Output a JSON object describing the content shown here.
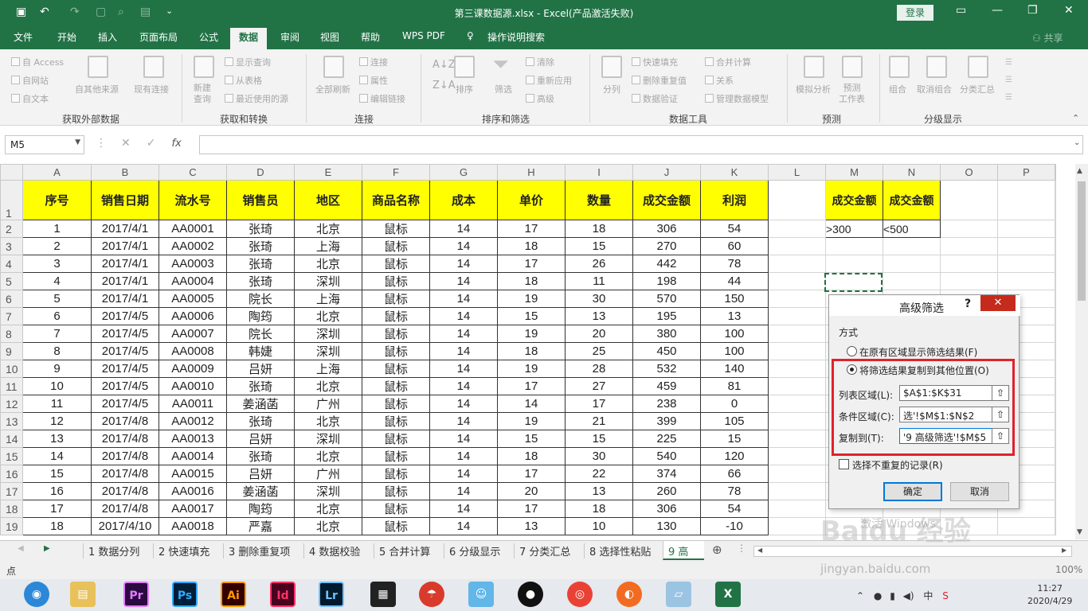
{
  "titlebar": {
    "title": "第三课数据源.xlsx  -  Excel(产品激活失败)",
    "login": "登录"
  },
  "tabs": [
    "文件",
    "开始",
    "插入",
    "页面布局",
    "公式",
    "数据",
    "审阅",
    "视图",
    "帮助",
    "WPS PDF",
    "操作说明搜索"
  ],
  "share": "共享",
  "ribbon": {
    "get_external": {
      "access": "自 Access",
      "web": "自网站",
      "text": "自文本",
      "other": "自其他来源",
      "existing": "现有连接",
      "group": "获取外部数据"
    },
    "transform": {
      "new_query": "新建\n查询",
      "show_queries": "显示查询",
      "from_table": "从表格",
      "recent": "最近使用的源",
      "group": "获取和转换"
    },
    "connections": {
      "refresh_all": "全部刷新",
      "connections": "连接",
      "properties": "属性",
      "edit_links": "编辑链接",
      "group": "连接"
    },
    "sort_filter": {
      "sort": "排序",
      "filter": "筛选",
      "clear": "清除",
      "reapply": "重新应用",
      "advanced": "高级",
      "group": "排序和筛选"
    },
    "data_tools": {
      "split": "分列",
      "flash_fill": "快速填充",
      "remove_dup": "删除重复值",
      "validation": "数据验证",
      "consolidate": "合并计算",
      "relations": "关系",
      "manage_model": "管理数据模型",
      "group": "数据工具"
    },
    "forecast": {
      "what_if": "模拟分析",
      "forecast_sheet": "预测\n工作表",
      "group": "预测"
    },
    "outline": {
      "group_btn": "组合",
      "ungroup": "取消组合",
      "subtotal": "分类汇总",
      "group": "分级显示"
    }
  },
  "formula_bar": {
    "name_box": "M5",
    "fx": "fx",
    "formula": ""
  },
  "columns": [
    "A",
    "B",
    "C",
    "D",
    "E",
    "F",
    "G",
    "H",
    "I",
    "J",
    "K",
    "L",
    "M",
    "N",
    "O",
    "P"
  ],
  "headers": [
    "序号",
    "销售日期",
    "流水号",
    "销售员",
    "地区",
    "商品名称",
    "成本",
    "单价",
    "数量",
    "成交金额",
    "利润"
  ],
  "rows": [
    [
      "1",
      "2017/4/1",
      "AA0001",
      "张琦",
      "北京",
      "鼠标",
      "14",
      "17",
      "18",
      "306",
      "54"
    ],
    [
      "2",
      "2017/4/1",
      "AA0002",
      "张琦",
      "上海",
      "鼠标",
      "14",
      "18",
      "15",
      "270",
      "60"
    ],
    [
      "3",
      "2017/4/1",
      "AA0003",
      "张琦",
      "北京",
      "鼠标",
      "14",
      "17",
      "26",
      "442",
      "78"
    ],
    [
      "4",
      "2017/4/1",
      "AA0004",
      "张琦",
      "深圳",
      "鼠标",
      "14",
      "18",
      "11",
      "198",
      "44"
    ],
    [
      "5",
      "2017/4/1",
      "AA0005",
      "院长",
      "上海",
      "鼠标",
      "14",
      "19",
      "30",
      "570",
      "150"
    ],
    [
      "6",
      "2017/4/5",
      "AA0006",
      "陶筠",
      "北京",
      "鼠标",
      "14",
      "15",
      "13",
      "195",
      "13"
    ],
    [
      "7",
      "2017/4/5",
      "AA0007",
      "院长",
      "深圳",
      "鼠标",
      "14",
      "19",
      "20",
      "380",
      "100"
    ],
    [
      "8",
      "2017/4/5",
      "AA0008",
      "韩婕",
      "深圳",
      "鼠标",
      "14",
      "18",
      "25",
      "450",
      "100"
    ],
    [
      "9",
      "2017/4/5",
      "AA0009",
      "吕妍",
      "上海",
      "鼠标",
      "14",
      "19",
      "28",
      "532",
      "140"
    ],
    [
      "10",
      "2017/4/5",
      "AA0010",
      "张琦",
      "北京",
      "鼠标",
      "14",
      "17",
      "27",
      "459",
      "81"
    ],
    [
      "11",
      "2017/4/5",
      "AA0011",
      "姜涵菡",
      "广州",
      "鼠标",
      "14",
      "14",
      "17",
      "238",
      "0"
    ],
    [
      "12",
      "2017/4/8",
      "AA0012",
      "张琦",
      "北京",
      "鼠标",
      "14",
      "19",
      "21",
      "399",
      "105"
    ],
    [
      "13",
      "2017/4/8",
      "AA0013",
      "吕妍",
      "深圳",
      "鼠标",
      "14",
      "15",
      "15",
      "225",
      "15"
    ],
    [
      "14",
      "2017/4/8",
      "AA0014",
      "张琦",
      "北京",
      "鼠标",
      "14",
      "18",
      "30",
      "540",
      "120"
    ],
    [
      "15",
      "2017/4/8",
      "AA0015",
      "吕妍",
      "广州",
      "鼠标",
      "14",
      "17",
      "22",
      "374",
      "66"
    ],
    [
      "16",
      "2017/4/8",
      "AA0016",
      "姜涵菡",
      "深圳",
      "鼠标",
      "14",
      "20",
      "13",
      "260",
      "78"
    ],
    [
      "17",
      "2017/4/8",
      "AA0017",
      "陶筠",
      "北京",
      "鼠标",
      "14",
      "17",
      "18",
      "306",
      "54"
    ],
    [
      "18",
      "2017/4/10",
      "AA0018",
      "严嘉",
      "北京",
      "鼠标",
      "14",
      "13",
      "10",
      "130",
      "-10"
    ]
  ],
  "criteria": {
    "h1": "成交金额",
    "h2": "成交金额",
    "v1": ">300",
    "v2": "<500"
  },
  "sheet_tabs": [
    "1 数据分列",
    "2 快速填充",
    "3 删除重复项",
    "4 数据校验",
    "5 合并计算",
    "6 分级显示",
    "7 分类汇总",
    "8 选择性粘贴",
    "9 高"
  ],
  "status": {
    "mode": "点",
    "zoom": "100%"
  },
  "dialog": {
    "title": "高级筛选",
    "help": "?",
    "close": "✕",
    "method": "方式",
    "opt1": "在原有区域显示筛选结果(F)",
    "opt2": "将筛选结果复制到其他位置(O)",
    "list_label": "列表区域(L):",
    "list_value": "$A$1:$K$31",
    "criteria_label": "条件区域(C):",
    "criteria_value": "选'!$M$1:$N$2",
    "copy_label": "复制到(T):",
    "copy_value": "'9 高级筛选'!$M$5",
    "unique": "选择不重复的记录(R)",
    "ok": "确定",
    "cancel": "取消"
  },
  "taskbar": {
    "apps": [
      "Pr",
      "Ps",
      "Ai",
      "Id",
      "Lr"
    ],
    "time": "11:27",
    "date": "2020/4/29",
    "ime": "中"
  },
  "watermark": {
    "brand": "Baidu 经验",
    "url": "jingyan.baidu.com",
    "activate": "激活 Windows"
  },
  "colors": {
    "excel_green": "#217346",
    "header_yellow": "#ffff00",
    "highlight_red": "#e0222b"
  }
}
